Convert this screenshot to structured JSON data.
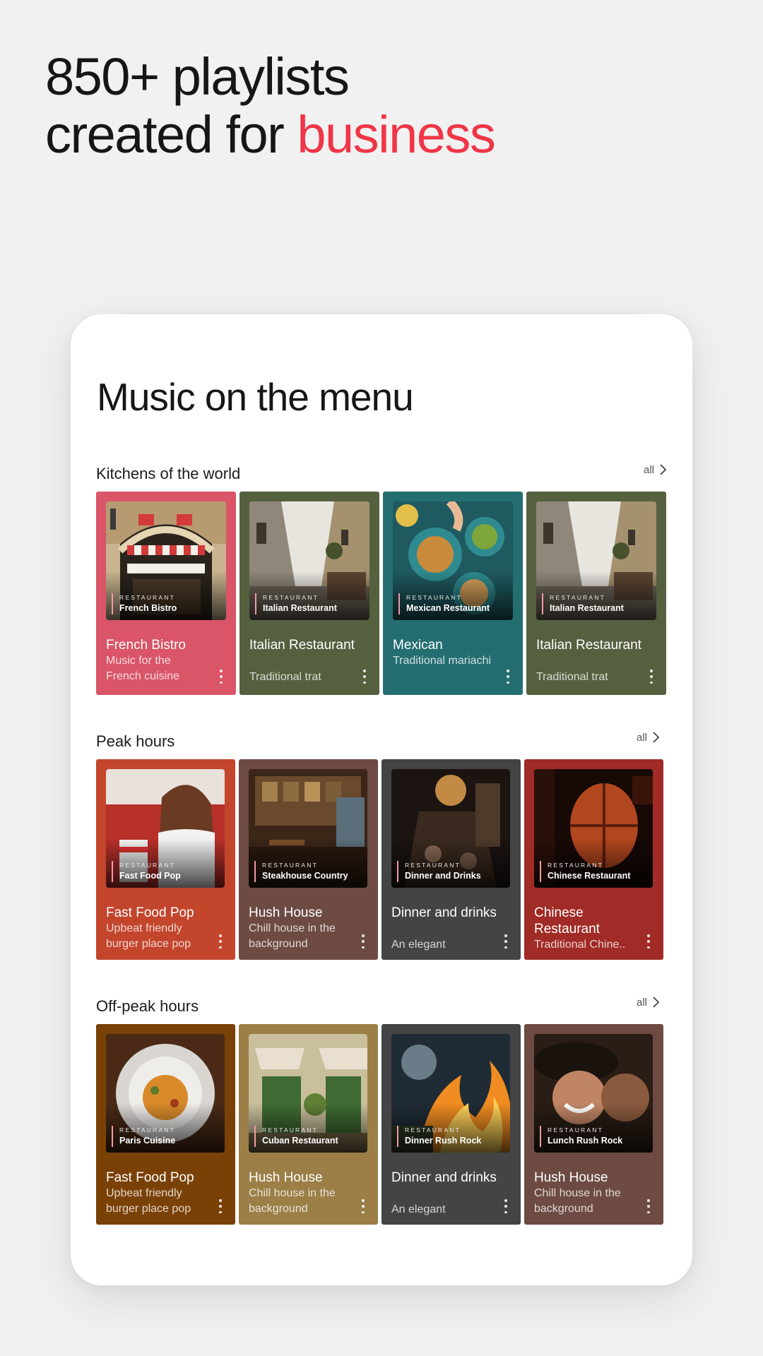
{
  "hero": {
    "line1": "850+ playlists",
    "line2_prefix": "created for ",
    "line2_accent": "business",
    "accent_color": "#ef3647"
  },
  "screen": {
    "title": "Music on the menu",
    "sections": [
      {
        "title": "Kitchens of the world",
        "all_label": "all",
        "cards": [
          {
            "title": "French Bistro",
            "subtitle": "Music for the French cuisine",
            "tag": "RESTAURANT",
            "art_name": "French Bistro",
            "color": "#d95567",
            "art": "bistro"
          },
          {
            "title": "Italian Restaurant",
            "subtitle": "Traditional trat",
            "tag": "RESTAURANT",
            "art_name": "Italian Restaurant",
            "color": "#55603f",
            "art": "alley"
          },
          {
            "title": "Mexican",
            "subtitle": "Traditional mariachi",
            "tag": "RESTAURANT",
            "art_name": "Mexican Restaurant",
            "color": "#246e71",
            "art": "mexican"
          },
          {
            "title": "Italian Restaurant",
            "subtitle": "Traditional trat",
            "tag": "RESTAURANT",
            "art_name": "Italian Restaurant",
            "color": "#55603f",
            "art": "alley"
          }
        ]
      },
      {
        "title": "Peak hours",
        "all_label": "all",
        "cards": [
          {
            "title": "Fast Food Pop",
            "subtitle": "Upbeat friendly burger place pop",
            "tag": "RESTAURANT",
            "art_name": "Fast Food Pop",
            "color": "#c2452c",
            "art": "fastfood"
          },
          {
            "title": "Hush House",
            "subtitle": "Chill house in the background",
            "tag": "RESTAURANT",
            "art_name": "Steakhouse Country",
            "color": "#6d4b42",
            "art": "steak"
          },
          {
            "title": "Dinner and drinks",
            "subtitle": "An elegant",
            "tag": "RESTAURANT",
            "art_name": "Dinner and Drinks",
            "color": "#444444",
            "art": "dinner"
          },
          {
            "title": "Chinese Restaurant",
            "subtitle": "Traditional Chine..",
            "tag": "RESTAURANT",
            "art_name": "Chinese Restaurant",
            "color": "#a12b26",
            "art": "chinese"
          }
        ]
      },
      {
        "title": "Off-peak hours",
        "all_label": "all",
        "cards": [
          {
            "title": "Fast Food Pop",
            "subtitle": "Upbeat friendly burger place pop",
            "tag": "RESTAURANT",
            "art_name": "Paris Cuisine",
            "color": "#7a4107",
            "art": "pasta"
          },
          {
            "title": "Hush House",
            "subtitle": "Chill house in the background",
            "tag": "RESTAURANT",
            "art_name": "Cuban Restaurant",
            "color": "#9b7f47",
            "art": "cuban"
          },
          {
            "title": "Dinner and drinks",
            "subtitle": "An elegant",
            "tag": "RESTAURANT",
            "art_name": "Dinner Rush Rock",
            "color": "#444444",
            "art": "flames"
          },
          {
            "title": "Hush House",
            "subtitle": "Chill house in the background",
            "tag": "RESTAURANT",
            "art_name": "Lunch Rush Rock",
            "color": "#6d4b42",
            "art": "laugh"
          }
        ]
      }
    ]
  }
}
